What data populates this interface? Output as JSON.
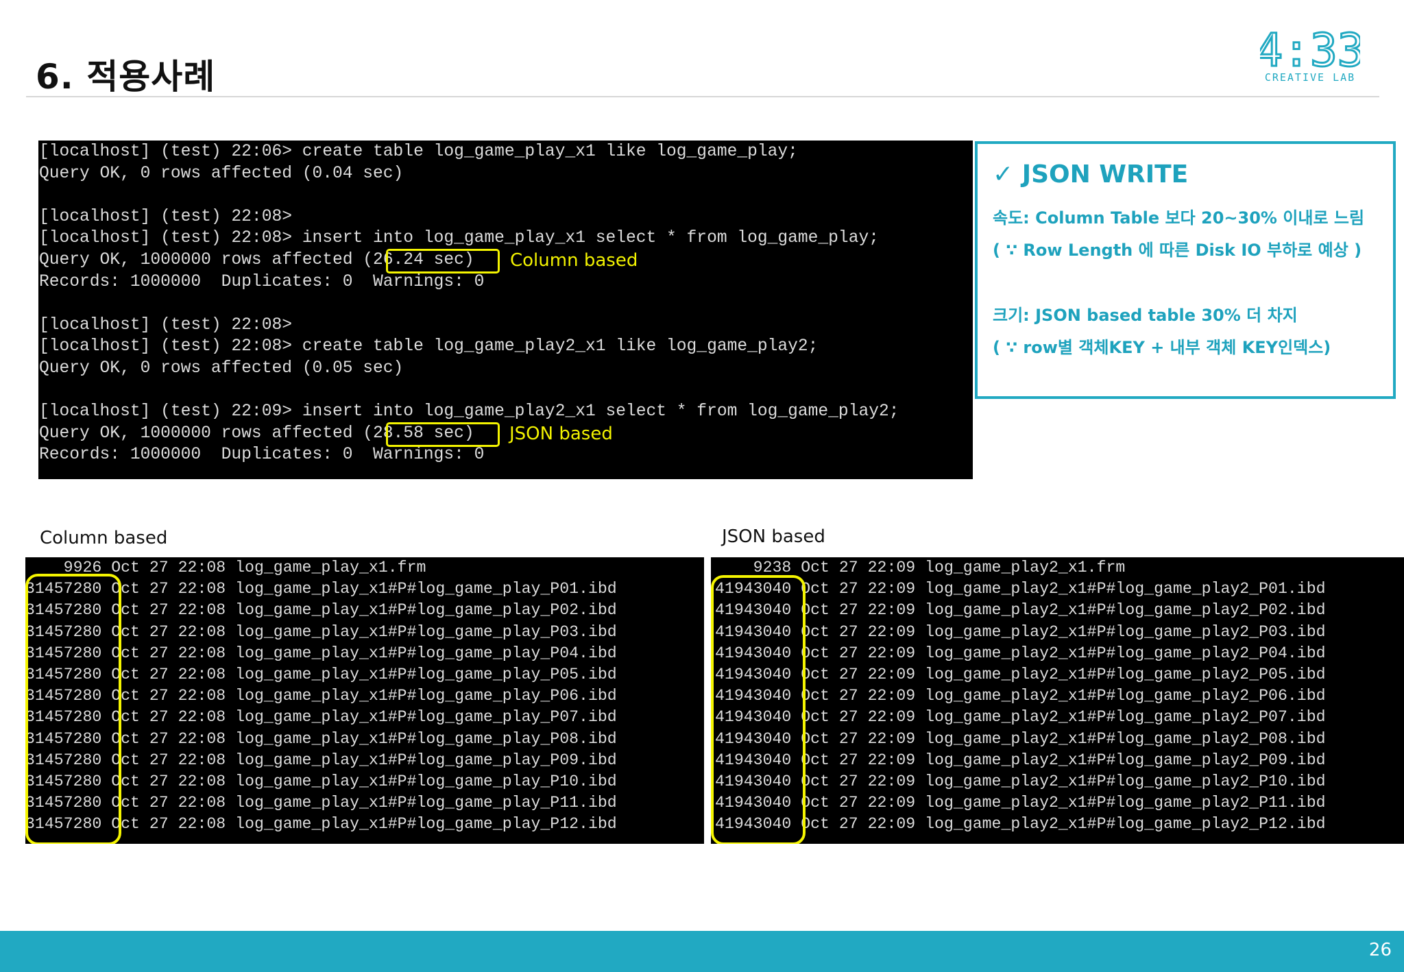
{
  "slide": {
    "title": "6. 적용사례",
    "page_number": "26",
    "brand_color": "#21a9c2"
  },
  "logo": {
    "main": "4:33",
    "sub": "CREATIVE LAB",
    "color": "#21a9c2"
  },
  "terminal_top": {
    "lines": [
      "[localhost] (test) 22:06> create table log_game_play_x1 like log_game_play;",
      "Query OK, 0 rows affected (0.04 sec)",
      "",
      "[localhost] (test) 22:08>",
      "[localhost] (test) 22:08> insert into log_game_play_x1 select * from log_game_play;",
      "Query OK, 1000000 rows affected (26.24 sec)",
      "Records: 1000000  Duplicates: 0  Warnings: 0",
      "",
      "[localhost] (test) 22:08>",
      "[localhost] (test) 22:08> create table log_game_play2_x1 like log_game_play2;",
      "Query OK, 0 rows affected (0.05 sec)",
      "",
      "[localhost] (test) 22:09> insert into log_game_play2_x1 select * from log_game_play2;",
      "Query OK, 1000000 rows affected (28.58 sec)",
      "Records: 1000000  Duplicates: 0  Warnings: 0"
    ],
    "annotation_column": "Column based",
    "annotation_json": "JSON based"
  },
  "info": {
    "title": "✓ JSON WRITE",
    "line1": "속도: Column Table 보다 20~30% 이내로 느림",
    "line2": "( ∵ Row Length 에 따른 Disk IO 부하로 예상 )",
    "line3": "크기: JSON based table 30% 더 차지",
    "line4": "( ∵ row별 객체KEY + 내부 객체 KEY인덱스)"
  },
  "captions": {
    "left": "Column based",
    "right": "JSON based"
  },
  "listing_column": {
    "lines": [
      "    9926 Oct 27 22:08 log_game_play_x1.frm",
      "31457280 Oct 27 22:08 log_game_play_x1#P#log_game_play_P01.ibd",
      "31457280 Oct 27 22:08 log_game_play_x1#P#log_game_play_P02.ibd",
      "31457280 Oct 27 22:08 log_game_play_x1#P#log_game_play_P03.ibd",
      "31457280 Oct 27 22:08 log_game_play_x1#P#log_game_play_P04.ibd",
      "31457280 Oct 27 22:08 log_game_play_x1#P#log_game_play_P05.ibd",
      "31457280 Oct 27 22:08 log_game_play_x1#P#log_game_play_P06.ibd",
      "31457280 Oct 27 22:08 log_game_play_x1#P#log_game_play_P07.ibd",
      "31457280 Oct 27 22:08 log_game_play_x1#P#log_game_play_P08.ibd",
      "31457280 Oct 27 22:08 log_game_play_x1#P#log_game_play_P09.ibd",
      "31457280 Oct 27 22:08 log_game_play_x1#P#log_game_play_P10.ibd",
      "31457280 Oct 27 22:08 log_game_play_x1#P#log_game_play_P11.ibd",
      "31457280 Oct 27 22:08 log_game_play_x1#P#log_game_play_P12.ibd"
    ]
  },
  "listing_json": {
    "lines": [
      "    9238 Oct 27 22:09 log_game_play2_x1.frm",
      "41943040 Oct 27 22:09 log_game_play2_x1#P#log_game_play2_P01.ibd",
      "41943040 Oct 27 22:09 log_game_play2_x1#P#log_game_play2_P02.ibd",
      "41943040 Oct 27 22:09 log_game_play2_x1#P#log_game_play2_P03.ibd",
      "41943040 Oct 27 22:09 log_game_play2_x1#P#log_game_play2_P04.ibd",
      "41943040 Oct 27 22:09 log_game_play2_x1#P#log_game_play2_P05.ibd",
      "41943040 Oct 27 22:09 log_game_play2_x1#P#log_game_play2_P06.ibd",
      "41943040 Oct 27 22:09 log_game_play2_x1#P#log_game_play2_P07.ibd",
      "41943040 Oct 27 22:09 log_game_play2_x1#P#log_game_play2_P08.ibd",
      "41943040 Oct 27 22:09 log_game_play2_x1#P#log_game_play2_P09.ibd",
      "41943040 Oct 27 22:09 log_game_play2_x1#P#log_game_play2_P10.ibd",
      "41943040 Oct 27 22:09 log_game_play2_x1#P#log_game_play2_P11.ibd",
      "41943040 Oct 27 22:09 log_game_play2_x1#P#log_game_play2_P12.ibd"
    ]
  }
}
